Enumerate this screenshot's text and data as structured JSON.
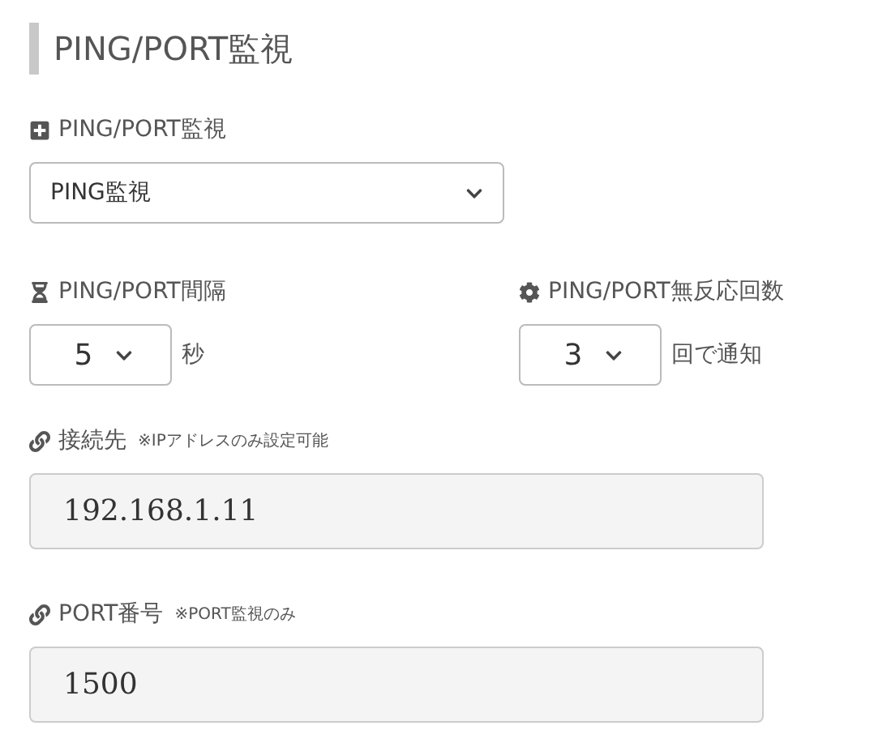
{
  "heading": "PING/PORT監視",
  "monitor_type": {
    "label": "PING/PORT監視",
    "value": "PING監視"
  },
  "interval": {
    "label": "PING/PORT間隔",
    "value": "5",
    "unit": "秒"
  },
  "retry": {
    "label": "PING/PORT無反応回数",
    "value": "3",
    "unit": "回で通知"
  },
  "destination": {
    "label": "接続先",
    "note": "※IPアドレスのみ設定可能",
    "value": "192.168.1.11"
  },
  "port": {
    "label": "PORT番号",
    "note": "※PORT監視のみ",
    "value": "1500"
  }
}
